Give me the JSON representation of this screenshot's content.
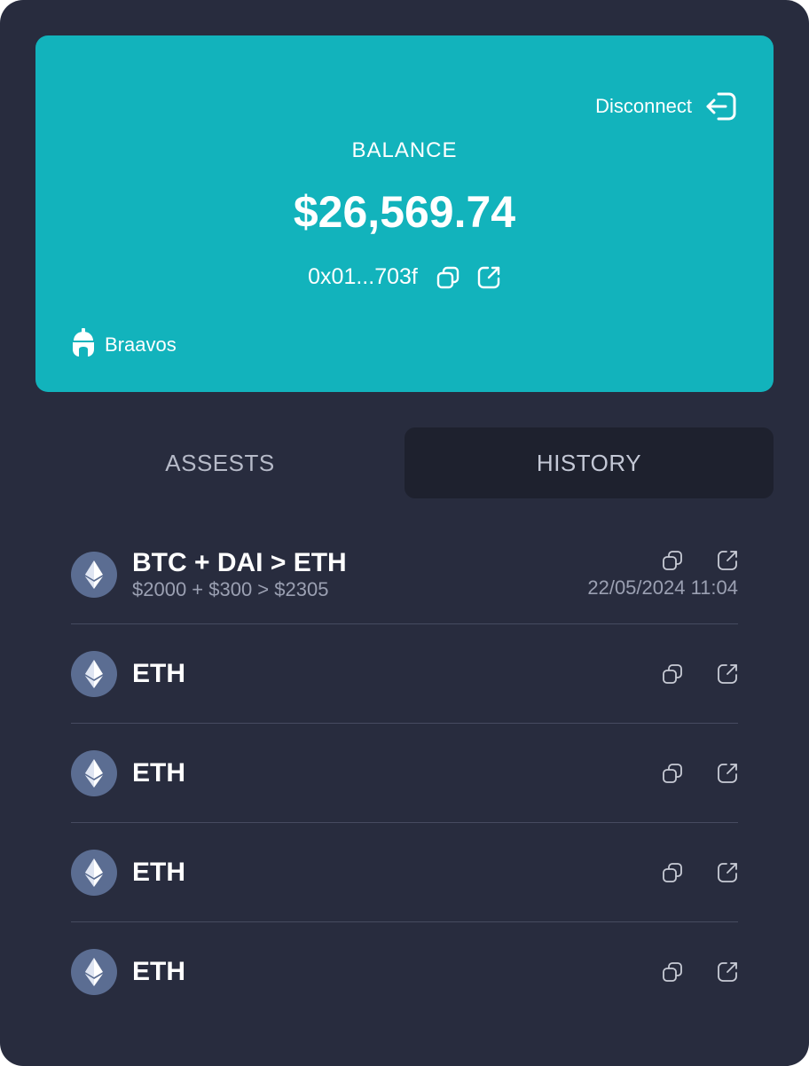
{
  "card": {
    "disconnect_label": "Disconnect",
    "balance_label": "BALANCE",
    "balance_value": "$26,569.74",
    "address": "0x01...703f",
    "brand_name": "Braavos"
  },
  "tabs": [
    {
      "label": "ASSESTS",
      "active": false
    },
    {
      "label": "HISTORY",
      "active": true
    }
  ],
  "history": [
    {
      "title": "BTC + DAI > ETH",
      "subtitle": "$2000 + $300 > $2305",
      "date": "22/05/2024 11:04",
      "icon": "ethereum-icon"
    },
    {
      "title": "ETH",
      "icon": "ethereum-icon"
    },
    {
      "title": "ETH",
      "icon": "ethereum-icon"
    },
    {
      "title": "ETH",
      "icon": "ethereum-icon"
    },
    {
      "title": "ETH",
      "icon": "ethereum-icon"
    }
  ],
  "colors": {
    "panel_bg": "#282c3e",
    "card_bg": "#12b3bc",
    "active_tab_bg": "#1e212e",
    "coin_bg": "#5b6d92",
    "divider": "#464b60"
  }
}
